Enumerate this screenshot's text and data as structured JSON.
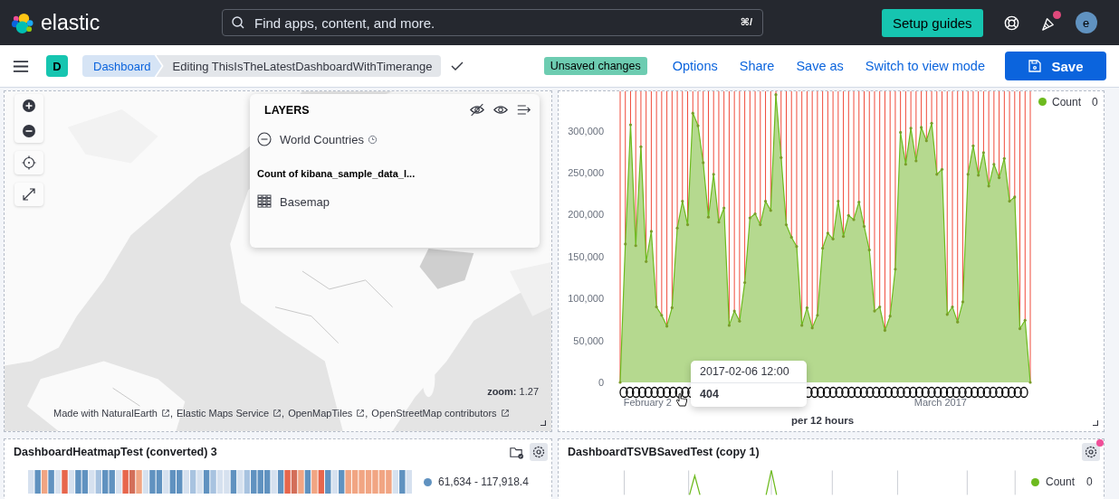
{
  "header": {
    "logo_text": "elastic",
    "search": {
      "placeholder": "Find apps, content, and more.",
      "shortcut": "⌘/"
    },
    "setup_button": "Setup guides",
    "notification": true,
    "avatar": "e"
  },
  "app_bar": {
    "space_initial": "D",
    "breadcrumbs": [
      {
        "label": "Dashboard",
        "selected": false
      },
      {
        "label": "Editing ThisIsTheLatestDashboardWithTimerange",
        "selected": true
      }
    ],
    "unsaved_badge": "Unsaved changes",
    "links": [
      "Options",
      "Share",
      "Save as",
      "Switch to view mode"
    ],
    "save_button": "Save"
  },
  "map_panel": {
    "layers": {
      "title": "LAYERS",
      "items": [
        {
          "kind": "vector",
          "label": "World Countries"
        },
        {
          "kind": "heading",
          "label": "Count of kibana_sample_data_l..."
        },
        {
          "kind": "tile",
          "label": "Basemap"
        }
      ]
    },
    "zoom": {
      "label": "zoom:",
      "value": "1.27"
    },
    "attribution": {
      "separator": ",",
      "links": [
        "Made with NaturalEarth",
        "Elastic Maps Service",
        "OpenMapTiles",
        "OpenStreetMap contributors"
      ]
    }
  },
  "chart_panel": {
    "chart_data": {
      "type": "area",
      "xlabel": "per 12 hours",
      "ylim": [
        0,
        347000
      ],
      "grid": true,
      "categories": [
        null,
        null,
        null,
        null,
        null,
        null,
        null,
        null,
        null,
        null,
        null,
        null,
        null,
        null,
        null,
        null,
        null,
        null,
        null,
        null,
        null,
        null,
        null,
        null,
        null,
        null,
        null,
        null,
        null,
        null,
        null,
        null,
        null,
        null,
        null,
        null,
        null,
        null,
        null,
        null,
        null,
        null,
        null,
        null,
        null,
        null,
        null,
        null,
        null,
        null,
        null,
        null,
        null,
        null,
        null,
        null,
        null,
        null,
        null,
        null,
        null,
        null,
        null,
        null,
        null,
        null,
        null,
        null,
        null,
        null,
        null,
        null,
        null,
        null,
        null,
        null,
        null,
        null,
        null,
        null
      ],
      "yticks": [
        {
          "value": 0,
          "label": "0"
        },
        {
          "value": 50000,
          "label": "50,000"
        },
        {
          "value": 100000,
          "label": "100,000"
        },
        {
          "value": 150000,
          "label": "150,000"
        },
        {
          "value": 200000,
          "label": "200,000"
        },
        {
          "value": 250000,
          "label": "250,000"
        },
        {
          "value": 300000,
          "label": "300,000"
        }
      ],
      "series": [
        {
          "name": "Count",
          "color": "#6dba1e",
          "values": [
            0,
            165000,
            307000,
            163000,
            281000,
            144000,
            180000,
            90000,
            80000,
            67000,
            89000,
            184000,
            216000,
            188000,
            321000,
            306000,
            262000,
            197000,
            248000,
            191000,
            208000,
            68000,
            85000,
            73000,
            119000,
            196000,
            201000,
            188000,
            216000,
            205000,
            343000,
            268000,
            188000,
            173000,
            162000,
            68000,
            89000,
            65000,
            80000,
            160000,
            178000,
            171000,
            216000,
            174000,
            199000,
            194000,
            215000,
            186000,
            158000,
            85000,
            90000,
            62000,
            79000,
            135000,
            298000,
            260000,
            303000,
            264000,
            304000,
            288000,
            309000,
            248000,
            254000,
            81000,
            90000,
            72000,
            96000,
            248000,
            282000,
            247000,
            274000,
            234000,
            260000,
            244000,
            267000,
            216000,
            221000,
            64000,
            74000,
            0
          ]
        }
      ]
    },
    "x_labels": [
      "February 2",
      "March 2017"
    ],
    "legend_value": "0",
    "tooltip": {
      "title": "2017-02-06 12:00",
      "value": "404"
    }
  },
  "heatmap_panel": {
    "title": "DashboardHeatmapTest (converted) 3",
    "legend": [
      {
        "label": "61,634 - 117,918.4",
        "color": "#6092c0"
      }
    ]
  },
  "tsvb_panel": {
    "title": "DashboardTSVBSavedTest (copy 1)",
    "notification": true,
    "legend": {
      "name": "Count",
      "value": "0",
      "color": "#6dba1e"
    }
  }
}
